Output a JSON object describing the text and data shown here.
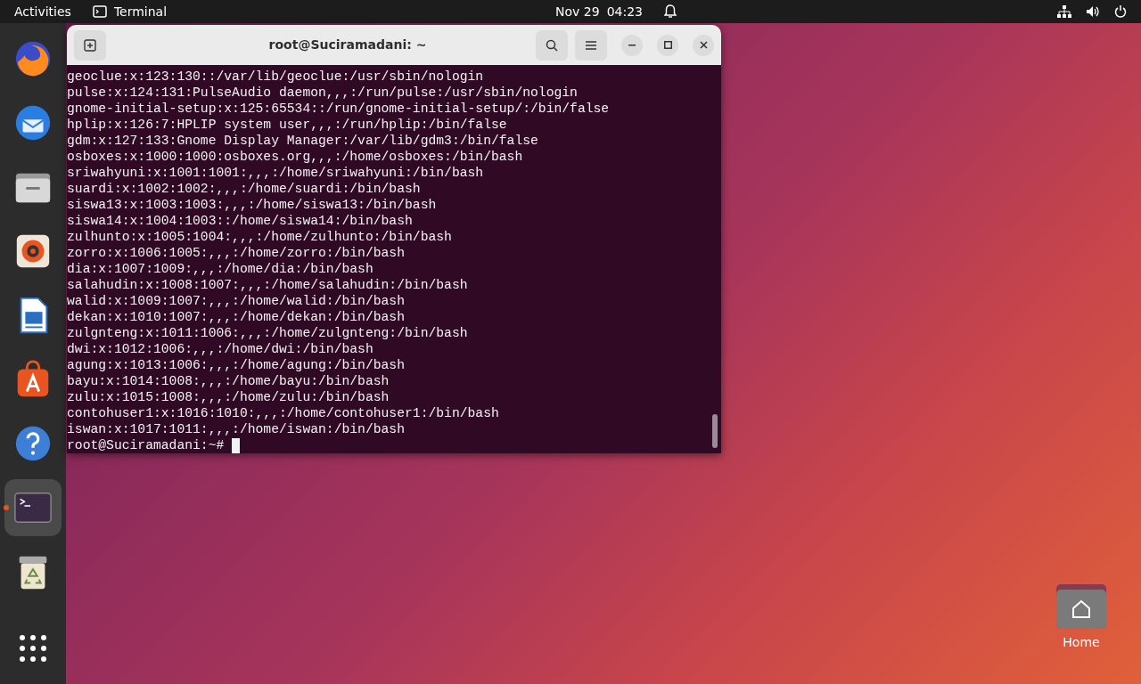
{
  "top_bar": {
    "activities": "Activities",
    "app_name": "Terminal",
    "date": "Nov 29",
    "time": "04:23"
  },
  "dock": {
    "items": [
      {
        "kind": "browser",
        "running": false
      },
      {
        "kind": "mail",
        "running": false
      },
      {
        "kind": "files",
        "running": false
      },
      {
        "kind": "music",
        "running": false
      },
      {
        "kind": "writer",
        "running": false
      },
      {
        "kind": "store",
        "running": false
      },
      {
        "kind": "help",
        "running": false
      },
      {
        "kind": "terminal",
        "running": true
      },
      {
        "kind": "trash",
        "running": false
      }
    ]
  },
  "terminal": {
    "title": "root@Suciramadani: ~",
    "lines": [
      "geoclue:x:123:130::/var/lib/geoclue:/usr/sbin/nologin",
      "pulse:x:124:131:PulseAudio daemon,,,:/run/pulse:/usr/sbin/nologin",
      "gnome-initial-setup:x:125:65534::/run/gnome-initial-setup/:/bin/false",
      "hplip:x:126:7:HPLIP system user,,,:/run/hplip:/bin/false",
      "gdm:x:127:133:Gnome Display Manager:/var/lib/gdm3:/bin/false",
      "osboxes:x:1000:1000:osboxes.org,,,:/home/osboxes:/bin/bash",
      "sriwahyuni:x:1001:1001:,,,:/home/sriwahyuni:/bin/bash",
      "suardi:x:1002:1002:,,,:/home/suardi:/bin/bash",
      "siswa13:x:1003:1003:,,,:/home/siswa13:/bin/bash",
      "siswa14:x:1004:1003::/home/siswa14:/bin/bash",
      "zulhunto:x:1005:1004:,,,:/home/zulhunto:/bin/bash",
      "zorro:x:1006:1005:,,,:/home/zorro:/bin/bash",
      "dia:x:1007:1009:,,,:/home/dia:/bin/bash",
      "salahudin:x:1008:1007:,,,:/home/salahudin:/bin/bash",
      "walid:x:1009:1007:,,,:/home/walid:/bin/bash",
      "dekan:x:1010:1007:,,,:/home/dekan:/bin/bash",
      "zulgnteng:x:1011:1006:,,,:/home/zulgnteng:/bin/bash",
      "dwi:x:1012:1006:,,,:/home/dwi:/bin/bash",
      "agung:x:1013:1006:,,,:/home/agung:/bin/bash",
      "bayu:x:1014:1008:,,,:/home/bayu:/bin/bash",
      "zulu:x:1015:1008:,,,:/home/zulu:/bin/bash",
      "contohuser1:x:1016:1010:,,,:/home/contohuser1:/bin/bash",
      "iswan:x:1017:1011:,,,:/home/iswan:/bin/bash"
    ],
    "prompt": "root@Suciramadani:~#"
  },
  "desktop_icons": [
    {
      "label": "Home"
    }
  ]
}
